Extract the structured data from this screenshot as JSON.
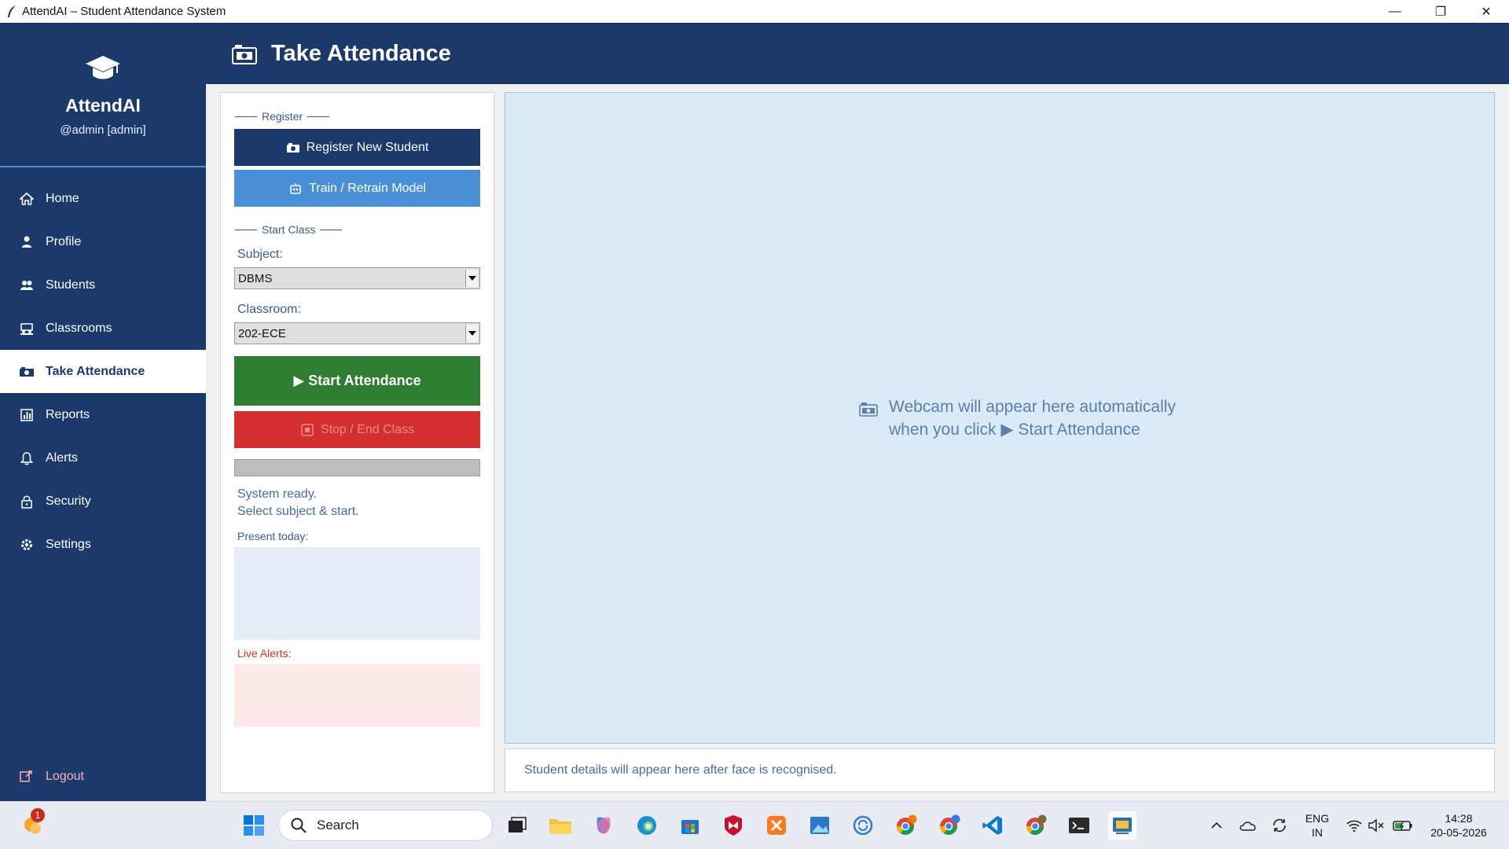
{
  "window": {
    "title": "AttendAI – Student Attendance System",
    "minimize": "—",
    "maximize": "❐",
    "close": "✕"
  },
  "brand": {
    "name": "AttendAI",
    "user": "@admin  [admin]"
  },
  "nav": {
    "items": [
      {
        "label": "Home",
        "icon": "home-icon"
      },
      {
        "label": "Profile",
        "icon": "person-icon"
      },
      {
        "label": "Students",
        "icon": "users-icon"
      },
      {
        "label": "Classrooms",
        "icon": "classroom-icon"
      },
      {
        "label": "Take Attendance",
        "icon": "camera-icon"
      },
      {
        "label": "Reports",
        "icon": "bar-chart-icon"
      },
      {
        "label": "Alerts",
        "icon": "bell-icon"
      },
      {
        "label": "Security",
        "icon": "lock-icon"
      },
      {
        "label": "Settings",
        "icon": "gear-icon"
      }
    ],
    "logout": "Logout"
  },
  "header": {
    "title": "Take Attendance"
  },
  "left": {
    "register_section": "Register",
    "register_btn": "Register New Student",
    "train_btn": "Train / Retrain Model",
    "start_section": "Start Class",
    "subject_label": "Subject:",
    "subject_value": "DBMS",
    "classroom_label": "Classroom:",
    "classroom_value": "202-ECE",
    "start_btn": "▶ Start Attendance",
    "stop_btn": "Stop / End Class",
    "status_line1": "System ready.",
    "status_line2": "Select subject & start.",
    "present_label": "Present today:",
    "alerts_label": "Live Alerts:"
  },
  "camera": {
    "line1": "Webcam will appear here automatically",
    "line2": "when you click ▶ Start Attendance"
  },
  "details": {
    "text": "Student details will appear here after face is recognised."
  },
  "taskbar": {
    "search": "Search",
    "notification_count": "1",
    "lang_line1": "ENG",
    "lang_line2": "IN",
    "time": "14:28",
    "date": "20-05-2026"
  },
  "colors": {
    "navy": "#1b3a6b",
    "accent_blue": "#4a90d9",
    "green": "#2e7d32",
    "red": "#d32f2f",
    "alerts_red": "#d32f2f"
  }
}
